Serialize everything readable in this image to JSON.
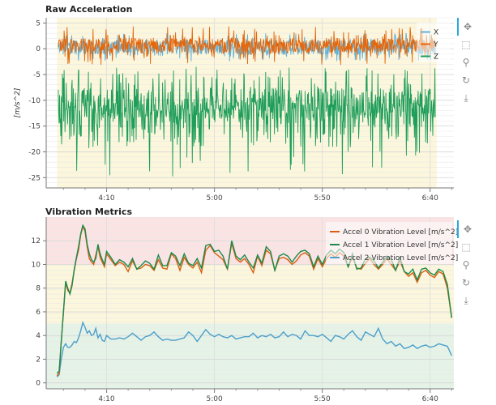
{
  "colors": {
    "x_series": "#e5660b",
    "y_series": "#1f9e5a",
    "z_series": "#64b1d6",
    "accel0": "#d95f0e",
    "accel1": "#1b8a4e",
    "accel2": "#4c9fcb",
    "band_yellow": "#fbf6dc",
    "band_red": "#fbe3e3",
    "band_green": "#e5f3e7",
    "toolbar_accent": "#26aae1"
  },
  "toolbar_icons": [
    "pan-icon",
    "box-zoom-icon",
    "wheel-zoom-icon",
    "reset-icon",
    "save-icon"
  ],
  "chart_data": [
    {
      "type": "line",
      "title": "Raw Acceleration",
      "xlabel": "",
      "ylabel": "[m/s^2]",
      "x_tick_labels": [
        "4:10",
        "5:00",
        "5:50",
        "6:40"
      ],
      "x_ticks_seconds": [
        250,
        300,
        350,
        400
      ],
      "xlim_seconds": [
        222,
        411
      ],
      "ylim": [
        -27,
        6
      ],
      "y_ticks": [
        5,
        0,
        -5,
        -10,
        -15,
        -20,
        -25
      ],
      "grid": true,
      "legend": "top-right",
      "background_band": {
        "from": 227,
        "to": 403,
        "color": "yellow"
      },
      "series": [
        {
          "name": "X",
          "band": {
            "center": 0.3,
            "low": -2,
            "high": 3.5
          }
        },
        {
          "name": "Y",
          "band": {
            "center": 0.6,
            "low": -2.5,
            "high": 5
          }
        },
        {
          "name": "Z",
          "band": {
            "center": -10.5,
            "low": -19,
            "high": -3.5,
            "min": -25
          }
        }
      ]
    },
    {
      "type": "line",
      "title": "Vibration Metrics",
      "xlabel": "",
      "ylabel": "",
      "x_tick_labels": [
        "4:10",
        "5:00",
        "5:50",
        "6:40"
      ],
      "x_ticks_seconds": [
        250,
        300,
        350,
        400
      ],
      "xlim_seconds": [
        222,
        411
      ],
      "ylim": [
        -0.5,
        14
      ],
      "y_ticks": [
        0,
        2,
        4,
        6,
        8,
        10,
        12
      ],
      "grid": true,
      "legend": "top-right",
      "threshold_bands": [
        {
          "from": -0.5,
          "to": 5,
          "color": "green"
        },
        {
          "from": 5,
          "to": 10,
          "color": "yellow"
        },
        {
          "from": 10,
          "to": 14,
          "color": "red"
        }
      ],
      "x_seconds": [
        227,
        228,
        229,
        230,
        231,
        232,
        233,
        234,
        235,
        236,
        237,
        238,
        239,
        240,
        241,
        242,
        243,
        244,
        245,
        246,
        247,
        248,
        249,
        250,
        252,
        254,
        256,
        258,
        260,
        262,
        264,
        266,
        268,
        270,
        272,
        274,
        276,
        278,
        280,
        282,
        284,
        286,
        288,
        290,
        292,
        294,
        296,
        298,
        300,
        302,
        304,
        306,
        308,
        310,
        312,
        314,
        316,
        318,
        320,
        322,
        324,
        326,
        328,
        330,
        332,
        334,
        336,
        338,
        340,
        342,
        344,
        346,
        348,
        350,
        352,
        354,
        356,
        358,
        360,
        362,
        364,
        366,
        368,
        370,
        372,
        374,
        376,
        378,
        380,
        382,
        384,
        386,
        388,
        390,
        392,
        394,
        396,
        398,
        400,
        402,
        404,
        406,
        408,
        410
      ],
      "series": [
        {
          "name": "Accel 0 Vibration Level [m/s^2]",
          "values": [
            0.6,
            0.8,
            3.5,
            6,
            8.5,
            7.8,
            7.6,
            8.4,
            9.5,
            10.5,
            11.2,
            12.5,
            13.2,
            12.8,
            11.5,
            10.5,
            10.2,
            10.0,
            10.8,
            11.5,
            10.6,
            10.2,
            9.8,
            10.9,
            10.4,
            9.9,
            10.2,
            10.0,
            9.4,
            10.3,
            9.6,
            9.7,
            10.0,
            9.9,
            9.5,
            10.4,
            9.7,
            9.6,
            10.9,
            10.5,
            9.5,
            10.6,
            10.0,
            9.7,
            10.2,
            9.3,
            11.2,
            11.6,
            11.0,
            10.7,
            10.4,
            9.6,
            11.8,
            10.5,
            10.2,
            10.5,
            10.0,
            9.3,
            10.7,
            9.9,
            11.2,
            10.9,
            9.5,
            10.5,
            10.6,
            10.4,
            10.0,
            10.3,
            10.8,
            11.0,
            10.7,
            9.6,
            10.5,
            9.8,
            10.5,
            10.9,
            10.6,
            11.0,
            10.7,
            9.8,
            10.6,
            9.7,
            9.6,
            10.1,
            10.5,
            10.0,
            9.6,
            10.0,
            10.5,
            10.0,
            9.5,
            10.3,
            9.4,
            9.0,
            9.3,
            8.5,
            9.3,
            9.5,
            9.1,
            8.9,
            9.4,
            9.2,
            8.0,
            5.5
          ]
        },
        {
          "name": "Accel 1 Vibration Level [m/s^2]",
          "values": [
            0.8,
            1.0,
            3.5,
            6,
            8.6,
            8.0,
            7.5,
            8.2,
            9.6,
            10.6,
            11.5,
            12.6,
            13.3,
            13.0,
            11.7,
            10.9,
            10.4,
            10.2,
            10.5,
            11.7,
            10.9,
            10.4,
            10.0,
            11.1,
            10.6,
            10.0,
            10.4,
            10.2,
            9.8,
            10.5,
            9.6,
            9.9,
            10.3,
            10.1,
            9.6,
            10.8,
            9.9,
            9.9,
            11.0,
            10.7,
            9.9,
            10.9,
            10.1,
            9.9,
            10.5,
            9.7,
            11.6,
            11.7,
            11.1,
            11.2,
            10.7,
            9.6,
            12.0,
            10.7,
            10.4,
            10.8,
            10.2,
            9.7,
            10.8,
            10.1,
            11.5,
            11.1,
            9.5,
            10.7,
            10.9,
            10.7,
            10.2,
            10.7,
            11.1,
            11.2,
            10.9,
            9.8,
            10.7,
            10.0,
            10.8,
            11.2,
            10.9,
            11.3,
            11.0,
            9.8,
            10.9,
            9.6,
            9.7,
            10.5,
            10.6,
            10.3,
            9.7,
            10.2,
            10.7,
            10.4,
            9.5,
            10.6,
            9.4,
            9.2,
            9.6,
            8.7,
            9.6,
            9.7,
            9.3,
            9.1,
            9.6,
            9.4,
            8.3,
            5.5
          ]
        },
        {
          "name": "Accel 2 Vibration Level [m/s^2]",
          "values": [
            0.5,
            0.7,
            2.0,
            3.0,
            3.3,
            3.0,
            3.0,
            3.2,
            3.5,
            3.4,
            3.8,
            4.4,
            5.1,
            4.7,
            4.2,
            4.4,
            4.0,
            4.1,
            4.6,
            3.8,
            4.1,
            3.6,
            3.5,
            4.0,
            3.7,
            3.7,
            3.8,
            3.7,
            3.9,
            4.2,
            3.9,
            3.6,
            3.9,
            4.0,
            4.3,
            3.9,
            3.6,
            3.7,
            3.6,
            3.6,
            3.7,
            3.8,
            4.3,
            4.0,
            3.5,
            4.0,
            4.5,
            4.1,
            3.9,
            4.1,
            3.9,
            3.8,
            4.0,
            3.7,
            3.8,
            3.9,
            3.9,
            4.2,
            3.8,
            4.0,
            3.9,
            4.1,
            3.8,
            3.9,
            4.3,
            3.9,
            4.1,
            4.0,
            3.7,
            4.4,
            4.0,
            4.0,
            3.9,
            4.1,
            3.8,
            3.5,
            4.0,
            3.9,
            3.7,
            4.1,
            4.4,
            3.9,
            3.6,
            4.3,
            4.1,
            3.9,
            4.6,
            3.7,
            3.3,
            3.5,
            3.1,
            3.3,
            2.9,
            3.0,
            3.2,
            2.9,
            3.1,
            3.2,
            3.0,
            3.1,
            3.3,
            3.2,
            3.1,
            2.3
          ]
        }
      ]
    }
  ]
}
